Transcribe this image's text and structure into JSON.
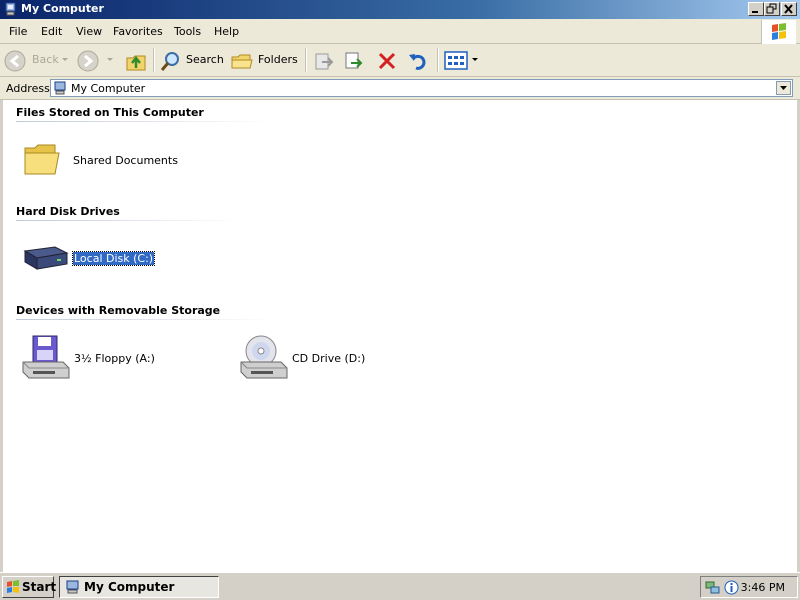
{
  "window": {
    "title": "My Computer"
  },
  "menu": {
    "items": [
      "File",
      "Edit",
      "View",
      "Favorites",
      "Tools",
      "Help"
    ]
  },
  "toolbar": {
    "back_label": "Back",
    "search_label": "Search",
    "folders_label": "Folders"
  },
  "address": {
    "label": "Address",
    "value": "My Computer"
  },
  "groups": [
    {
      "header": "Files Stored on This Computer",
      "items": [
        {
          "label": "Shared Documents",
          "icon": "folder-icon",
          "selected": false
        }
      ]
    },
    {
      "header": "Hard Disk Drives",
      "items": [
        {
          "label": "Local Disk (C:)",
          "icon": "hard-disk-icon",
          "selected": true
        }
      ]
    },
    {
      "header": "Devices with Removable Storage",
      "items": [
        {
          "label": "3½ Floppy (A:)",
          "icon": "floppy-drive-icon",
          "selected": false
        },
        {
          "label": "CD Drive (D:)",
          "icon": "cd-drive-icon",
          "selected": false
        }
      ]
    }
  ],
  "taskbar": {
    "start_label": "Start",
    "task_label": "My Computer",
    "clock": "3:46 PM"
  },
  "colors": {
    "title_bar": "#0a246a",
    "selection": "#316ac5",
    "chrome": "#ece9d8"
  }
}
